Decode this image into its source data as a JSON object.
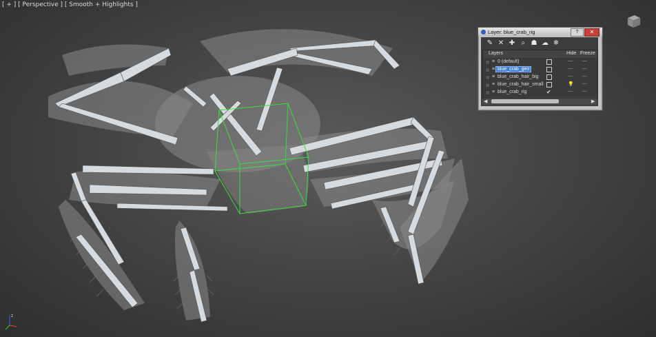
{
  "viewport": {
    "label": "[ + ] [ Perspective ] [ Smooth + Highlights ]",
    "model": "blue crab rig",
    "gizmo_z": "z",
    "bone_color": "#d8dde2",
    "mesh_color": "#9a9a9a",
    "selection_color": "#36e13a"
  },
  "layer_dialog": {
    "title": "Layer: blue_crab_rig",
    "help_label": "?",
    "close_label": "✕",
    "toolbar": [
      {
        "name": "create-layer-icon",
        "glyph": "✎"
      },
      {
        "name": "delete-layer-icon",
        "glyph": "✕"
      },
      {
        "name": "add-to-layer-icon",
        "glyph": "✚"
      },
      {
        "name": "select-in-layer-icon",
        "glyph": "⌕"
      },
      {
        "name": "highlight-layer-icon",
        "glyph": "☗"
      },
      {
        "name": "hide-all-icon",
        "glyph": "☁"
      },
      {
        "name": "freeze-all-icon",
        "glyph": "❄"
      }
    ],
    "columns": {
      "layers": "Layers",
      "hide": "Hide",
      "freeze": "Freeze"
    },
    "rows": [
      {
        "name": "0 (default)",
        "checkbox": true,
        "check": "",
        "hide": "—",
        "freeze": "—",
        "selected": false
      },
      {
        "name": "blue_crab_geo",
        "checkbox": true,
        "check": "",
        "hide": "—",
        "freeze": "—",
        "selected": true
      },
      {
        "name": "blue_crab_hair_big",
        "checkbox": true,
        "check": "",
        "hide": "—",
        "freeze": "—",
        "selected": false
      },
      {
        "name": "blue_crab_hair_small",
        "checkbox": true,
        "check": "",
        "hide": "💡",
        "freeze": "—",
        "selected": false
      },
      {
        "name": "blue_crab_rig",
        "checkbox": false,
        "check": "✔",
        "hide": "—",
        "freeze": "—",
        "selected": false
      }
    ],
    "scroll_left": "◀",
    "scroll_right": "▶",
    "scroll_thumb": "III"
  }
}
